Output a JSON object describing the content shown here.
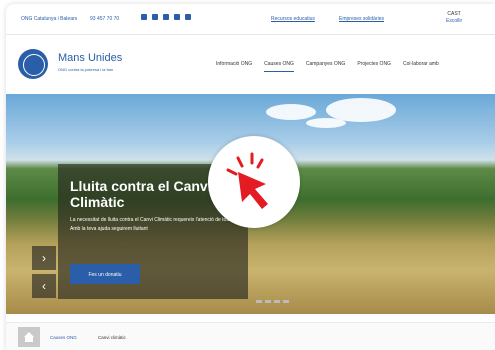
{
  "topbar": {
    "org": "ONG Catalunya i Balears",
    "phone": "93 457 70 70",
    "socials": [
      "mail-icon",
      "facebook-icon",
      "twitter-icon",
      "googleplus-icon",
      "youtube-icon"
    ],
    "links": [
      "Recursos educatius",
      "Empreses solidàries"
    ],
    "lang_label": "CAST",
    "lang_action": "Escollir"
  },
  "header": {
    "brand": "Mans Unides",
    "tagline": "ONG contra la pobresa i la fam",
    "nav": [
      "Informació ONG",
      "Causes ONG",
      "Campanyes ONG",
      "Projectes ONG",
      "Col·laborar amb"
    ]
  },
  "hero": {
    "title": "Lluita contra el Canvi Climàtic",
    "body": "La necessitat de lluita contra el Canvi Climàtic requereix l'atenció de tots. Amb la teva ajuda seguirem lluitant",
    "cta": "Fes un donatiu"
  },
  "breadcrumb": {
    "parent": "Causes ONG",
    "current": "Canvi climàtic"
  },
  "colors": {
    "accent": "#2a5ea8",
    "cursor": "#e31b23"
  }
}
